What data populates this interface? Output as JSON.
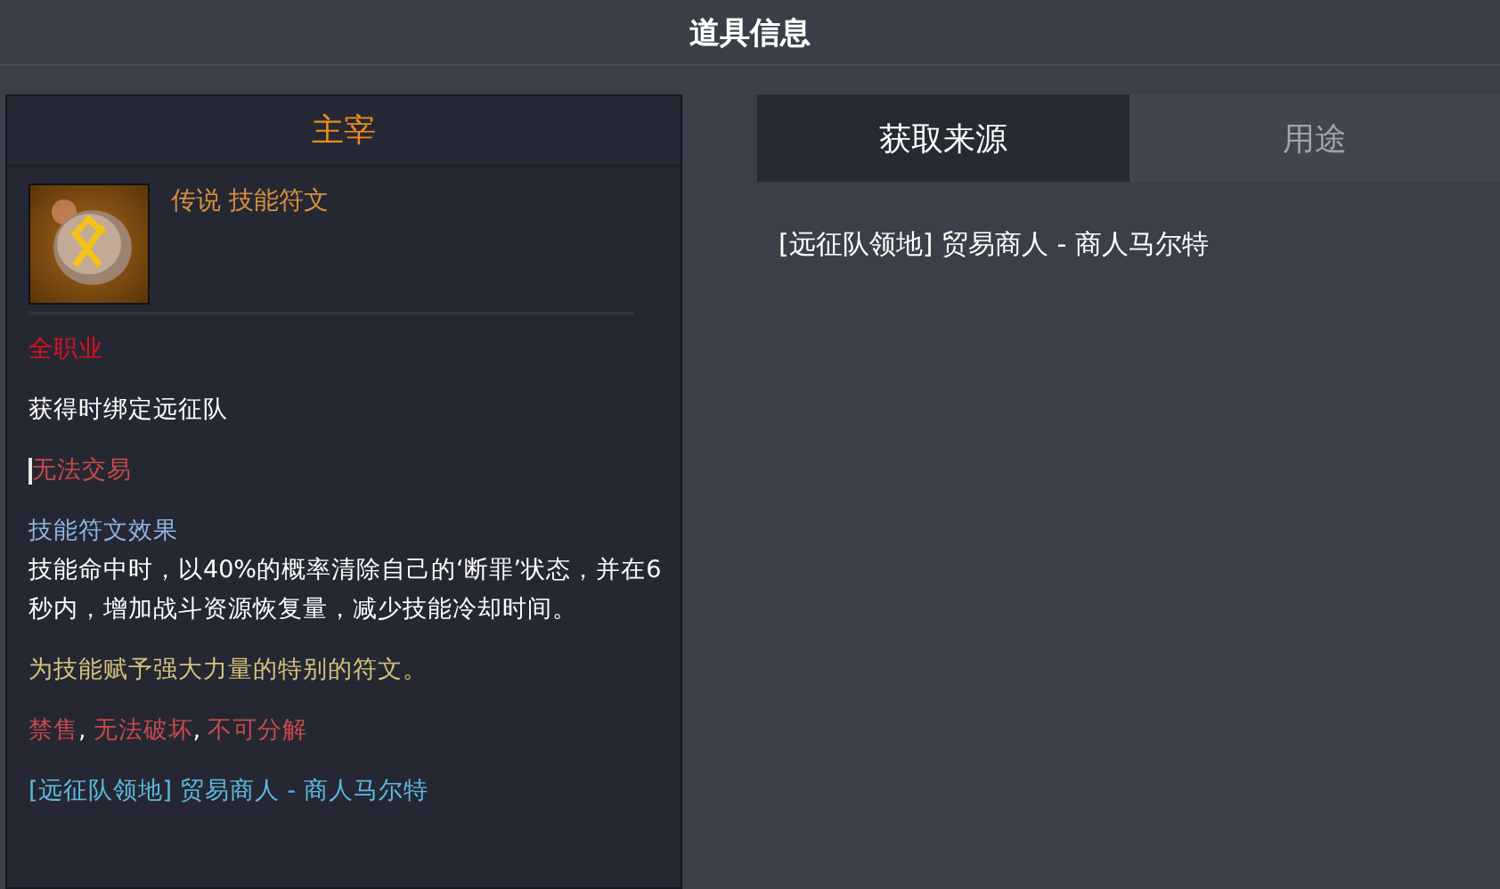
{
  "window": {
    "title": "道具信息"
  },
  "item": {
    "name": "主宰",
    "grade_type": "传说 技能符文",
    "class": "全职业",
    "binding": "获得时绑定远征队",
    "trade": "无法交易",
    "effect_title": "技能符文效果",
    "effect_text": "技能命中时，以40%的概率清除自己的‘断罪’状态，并在6秒内，增加战斗资源恢复量，减少技能冷却时间。",
    "flavor": "为技能赋予强大力量的特别的符文。",
    "restrictions": [
      {
        "text": "禁售",
        "separator": ","
      },
      {
        "text": "无法破坏",
        "separator": ","
      },
      {
        "text": "不可分解"
      }
    ],
    "source": "[远征队领地] 贸易商人 - 商人马尔特"
  },
  "tabs": [
    {
      "label": "获取来源",
      "selected": true
    },
    {
      "label": "用途",
      "selected": false
    }
  ],
  "sources": [
    "[远征队领地] 贸易商人 - 商人马尔特"
  ]
}
